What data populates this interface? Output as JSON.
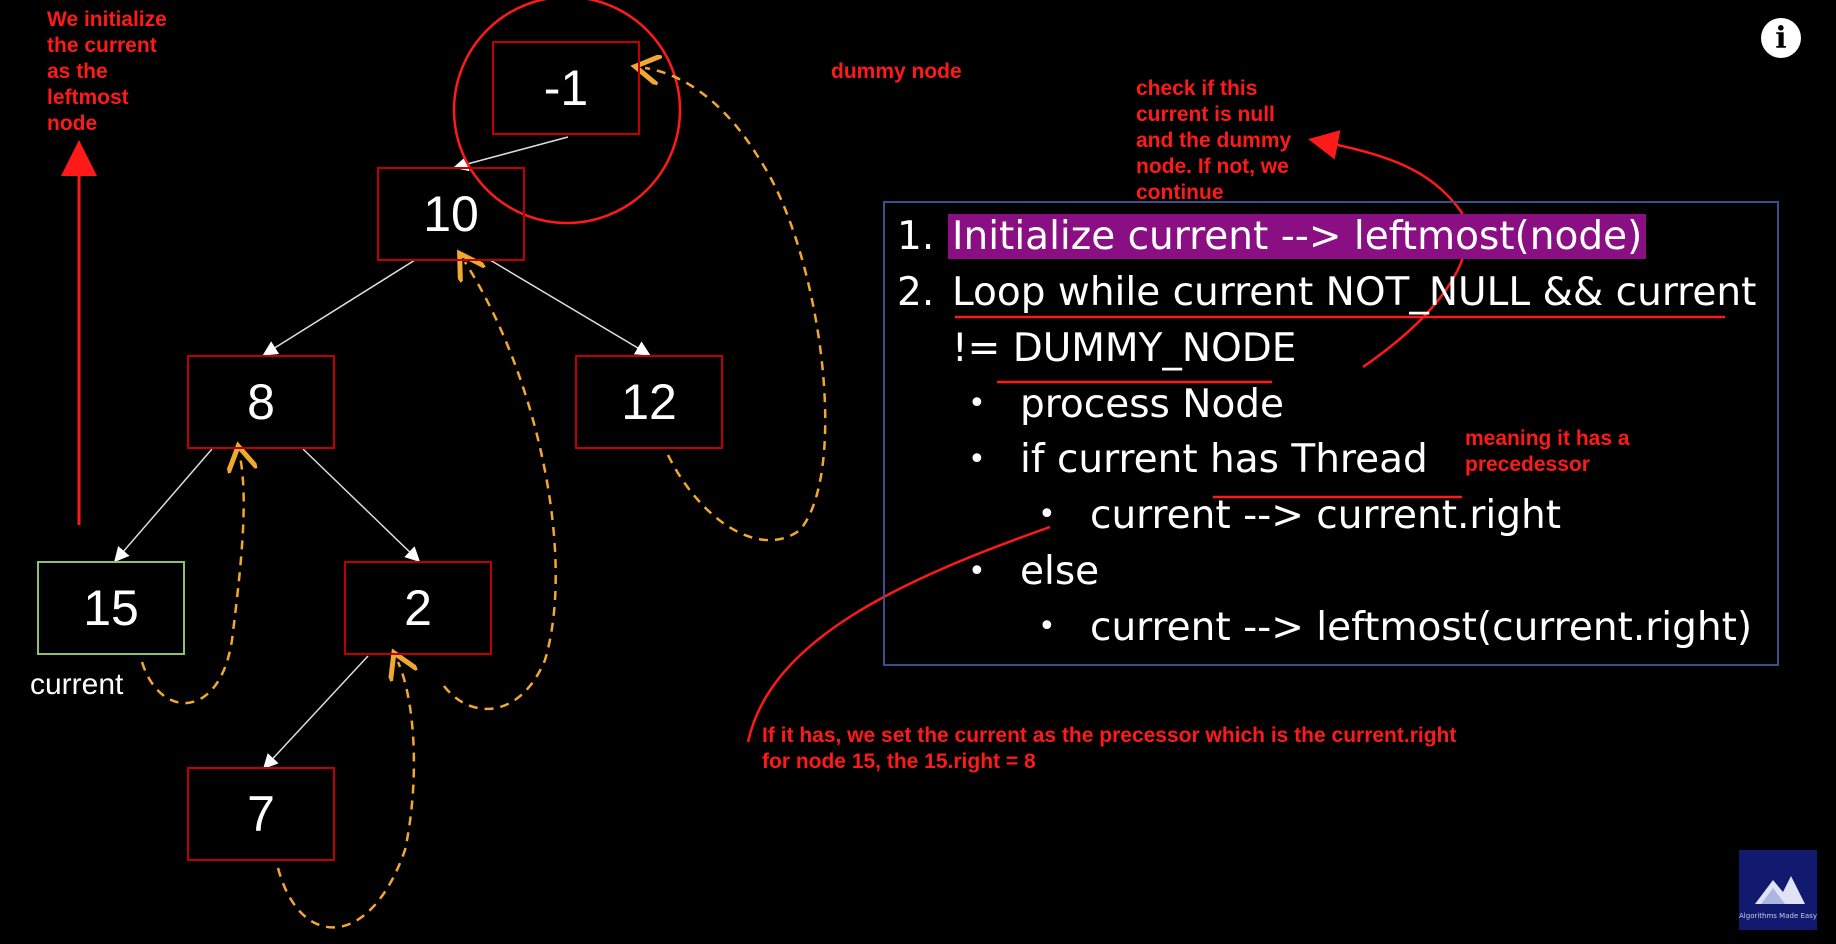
{
  "colors": {
    "background": "#000000",
    "node_border": "#c00000",
    "current_border": "#8fbf6f",
    "annotation": "#ff1a1a",
    "thread_arrow": "#f0a830",
    "highlight": "#8a0f82",
    "box_border": "#3b4f8c"
  },
  "nodes": {
    "root_dummy": "-1",
    "n10": "10",
    "n8": "8",
    "n12": "12",
    "n15": "15",
    "n2": "2",
    "n7": "7"
  },
  "current_label": "current",
  "annotations": {
    "init_note": "We initialize\nthe current\nas the\nleftmost\nnode",
    "dummy_note": "dummy node",
    "check_note": "check if this\ncurrent is null\nand the dummy\nnode. If not, we\ncontinue",
    "meaning_note": "meaning it has a\nprecedessor",
    "thread_note_line1": "If it has, we set the current as the precessor which is the current.right",
    "thread_note_line2": "for node 15, the 15.right = 8"
  },
  "algorithm": {
    "step1_num": "1.",
    "step1_text": "Initialize current --> leftmost(node)",
    "step2_num": "2.",
    "step2_line1": "Loop while current NOT_NULL && current",
    "step2_line2": "!= DUMMY_NODE",
    "bullet_process": "process Node",
    "bullet_if": "if current has Thread",
    "sub_thread": "current --> current.right",
    "bullet_else": "else",
    "sub_else": "current --> leftmost(current.right)",
    "bullet_glyph": "•"
  },
  "info_icon": "i",
  "logo_text": "Algorithms Made Easy"
}
